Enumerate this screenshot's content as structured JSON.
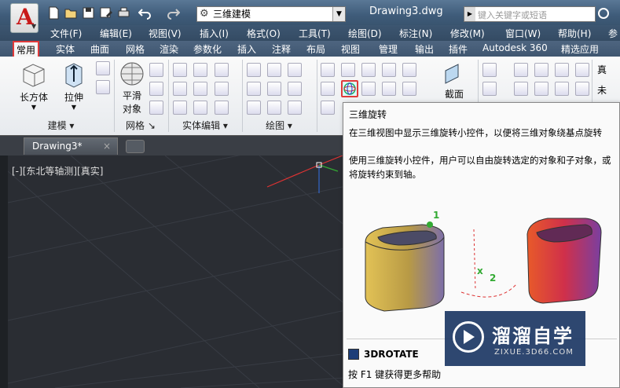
{
  "title_bar": {
    "workspace": "三维建模",
    "doc_title": "Drawing3.dwg",
    "search_placeholder": "键入关键字或短语",
    "qat_icons": [
      "new-icon",
      "open-icon",
      "save-icon",
      "saveas-icon",
      "print-icon",
      "undo-icon",
      "redo-icon"
    ]
  },
  "menu": [
    "文件(F)",
    "编辑(E)",
    "视图(V)",
    "插入(I)",
    "格式(O)",
    "工具(T)",
    "绘图(D)",
    "标注(N)",
    "修改(M)",
    "窗口(W)",
    "帮助(H)",
    "参"
  ],
  "ribbon_tabs": [
    "常用",
    "实体",
    "曲面",
    "网格",
    "渲染",
    "参数化",
    "插入",
    "注释",
    "布局",
    "视图",
    "管理",
    "输出",
    "插件",
    "Autodesk 360",
    "精选应用"
  ],
  "ribbon": {
    "big_buttons": {
      "box": "长方体",
      "extrude": "拉伸",
      "smooth_line1": "平滑",
      "smooth_line2": "对象",
      "section": "截面"
    },
    "panels": [
      "建模",
      "网格",
      "实体编辑",
      "绘图"
    ],
    "right_labels": [
      "真",
      "未"
    ]
  },
  "file_tab": "Drawing3*",
  "viewport_label": "[-][东北等轴测][真实]",
  "tooltip": {
    "title": "三维旋转",
    "desc1": "在三维视图中显示三维旋转小控件，以便将三维对象绕基点旋转",
    "desc2": "使用三维旋转小控件，用户可以自由旋转选定的对象和子对象，或将旋转约束到轴。",
    "command": "3DROTATE",
    "help": "按 F1 键获得更多帮助",
    "label_1": "1",
    "label_2": "2",
    "label_x": "x"
  },
  "watermark": {
    "title": "溜溜自学",
    "sub": "ZIXUE.3D66.COM"
  },
  "colors": {
    "accent_red": "#e03a3a",
    "title_blue": "#3f5c7a",
    "viewport": "#2a2d33"
  }
}
